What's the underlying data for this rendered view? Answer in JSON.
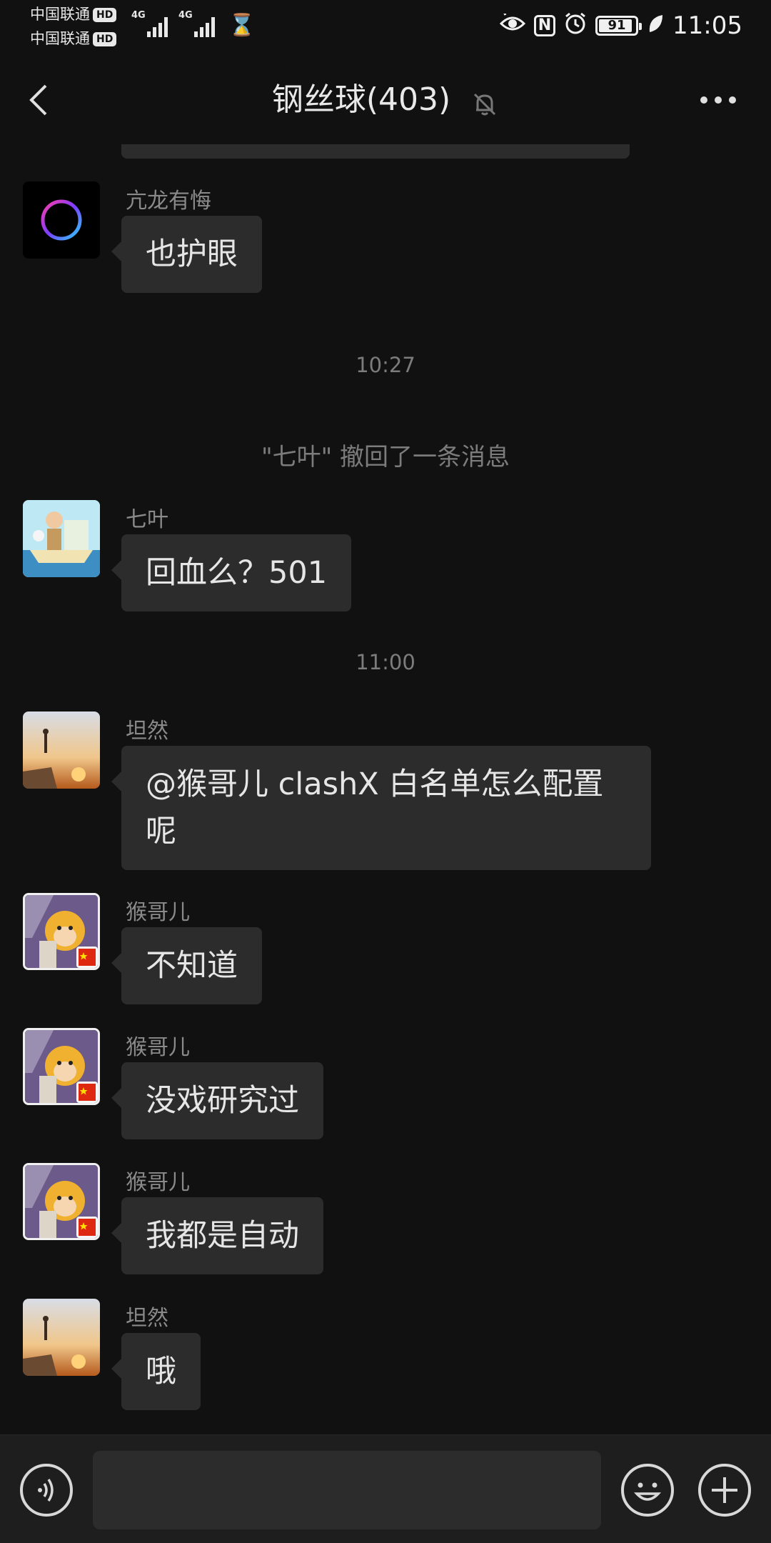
{
  "status_bar": {
    "carrier1": "中国联通",
    "carrier2": "中国联通",
    "hd": "HD",
    "net1": "4G",
    "net2": "4G",
    "battery_level": 91,
    "battery_text": "91",
    "time": "11:05",
    "icons": [
      "eye-icon",
      "nfc-icon",
      "alarm-icon",
      "battery-icon",
      "leaf-icon",
      "hourglass-icon"
    ]
  },
  "header": {
    "title": "钢丝球(403)",
    "icons": [
      "back-icon",
      "mute-bell-icon",
      "more-icon"
    ]
  },
  "messages": [
    {
      "type": "message",
      "sender": "亢龙有悔",
      "text": "也护眼",
      "avatar": "ring-avatar"
    },
    {
      "type": "time",
      "text": "10:27"
    },
    {
      "type": "system",
      "text": "\"七叶\" 撤回了一条消息"
    },
    {
      "type": "message",
      "sender": "七叶",
      "text": "回血么？501",
      "avatar": "cartoon-boat-avatar"
    },
    {
      "type": "time",
      "text": "11:00"
    },
    {
      "type": "message",
      "sender": "坦然",
      "text": "@猴哥儿  clashX 白名单怎么配置呢",
      "avatar": "sunset-avatar"
    },
    {
      "type": "message",
      "sender": "猴哥儿",
      "text": "不知道",
      "avatar": "monkey-king-avatar"
    },
    {
      "type": "message",
      "sender": "猴哥儿",
      "text": "没戏研究过",
      "avatar": "monkey-king-avatar"
    },
    {
      "type": "message",
      "sender": "猴哥儿",
      "text": "我都是自动",
      "avatar": "monkey-king-avatar"
    },
    {
      "type": "message",
      "sender": "坦然",
      "text": "哦",
      "avatar": "sunset-avatar"
    }
  ],
  "input_bar": {
    "input_value": "",
    "icons": [
      "voice-icon",
      "emoji-icon",
      "plus-icon"
    ]
  }
}
